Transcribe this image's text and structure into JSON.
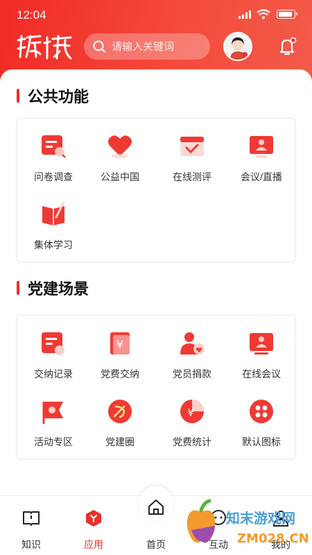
{
  "status_bar": {
    "time": "12:04"
  },
  "header": {
    "logo_text": "旗帜",
    "search_placeholder": "请输入关键词"
  },
  "sections": [
    {
      "title": "公共功能",
      "items": [
        {
          "label": "问卷调查",
          "icon": "questionnaire-icon"
        },
        {
          "label": "公益中国",
          "icon": "heart-icon"
        },
        {
          "label": "在线测评",
          "icon": "calendar-check-icon"
        },
        {
          "label": "会议/直播",
          "icon": "screen-person-icon"
        },
        {
          "label": "集体学习",
          "icon": "book-pen-icon"
        }
      ]
    },
    {
      "title": "党建场景",
      "items": [
        {
          "label": "交纳记录",
          "icon": "record-icon"
        },
        {
          "label": "党费交纳",
          "icon": "yuan-doc-icon"
        },
        {
          "label": "党员捐款",
          "icon": "member-heart-icon"
        },
        {
          "label": "在线会议",
          "icon": "monitor-person-icon"
        },
        {
          "label": "活动专区",
          "icon": "flag-icon"
        },
        {
          "label": "党建圈",
          "icon": "party-circle-icon"
        },
        {
          "label": "党费统计",
          "icon": "yuan-pie-icon"
        },
        {
          "label": "默认图标",
          "icon": "four-dots-icon"
        }
      ]
    }
  ],
  "tabbar": {
    "tabs": [
      {
        "label": "知识",
        "icon": "book-icon"
      },
      {
        "label": "应用",
        "icon": "apps-icon",
        "active": true
      },
      {
        "label": "首页",
        "icon": "home-icon"
      },
      {
        "label": "互动",
        "icon": "chat-icon"
      },
      {
        "label": "我的",
        "icon": "user-icon"
      }
    ]
  },
  "watermark": {
    "brand": "知末游戏网",
    "site": "ZM028.CN"
  },
  "colors": {
    "primary": "#e8322b",
    "header_start": "#f12a26",
    "header_end": "#f35b4a"
  }
}
